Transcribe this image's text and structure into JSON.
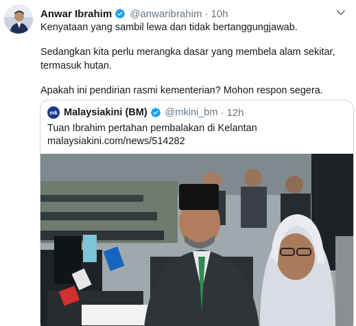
{
  "tweet": {
    "display_name": "Anwar Ibrahim",
    "handle": "@anwaribrahim",
    "separator": "·",
    "time": "10h",
    "lines": [
      "Kenyataan yang sambil lewa dan tidak bertanggungjawab.",
      "Sedangkan kita perlu merangka dasar yang membela alam sekitar, termasuk hutan.",
      "Apakah ini pendirian rasmi kementerian? Mohon respon segera."
    ]
  },
  "quoted": {
    "avatar_text": "mk",
    "display_name": "Malaysiakini (BM)",
    "handle": "@mkini_bm",
    "separator": "·",
    "time": "12h",
    "text": "Tuan Ibrahim pertahan pembalakan di Kelantan",
    "link": "malaysiakini.com/news/514282"
  },
  "colors": {
    "text": "#14171a",
    "secondary": "#657786",
    "verified": "#1da1f2",
    "border": "#ccd6dd"
  },
  "icons": {
    "verified": "verified-badge-icon",
    "caret": "chevron-down-icon"
  }
}
